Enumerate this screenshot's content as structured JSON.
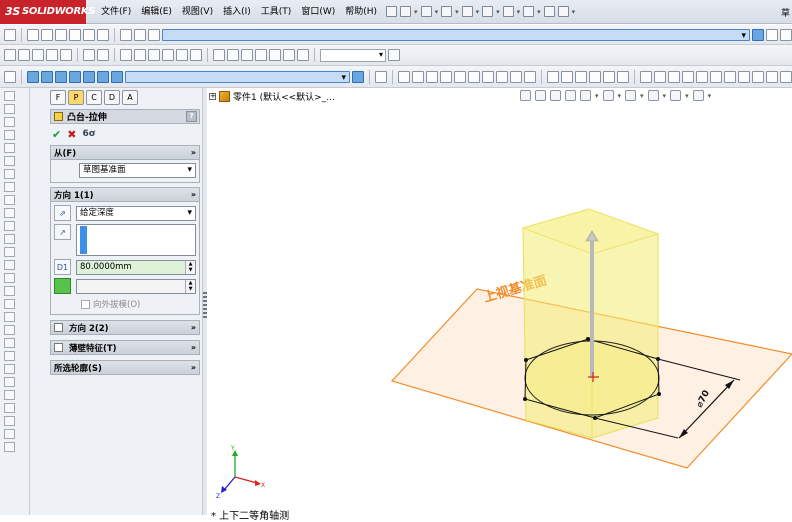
{
  "app": {
    "brand": "SOLIDWORKS",
    "corner_text": "草"
  },
  "menu": [
    "文件(F)",
    "编辑(E)",
    "视图(V)",
    "插入(I)",
    "工具(T)",
    "窗口(W)",
    "帮助(H)"
  ],
  "feature_tabs": [
    "F",
    "P",
    "C",
    "D",
    "A"
  ],
  "feature": {
    "title": "凸台-拉伸",
    "help": "?",
    "confirm": {
      "ok": "✔",
      "cancel": "✖",
      "pin": "6ơ"
    },
    "from": {
      "header": "从(F)",
      "chevron": "»",
      "value": "草图基准面"
    },
    "direction1": {
      "header": "方向 1(1)",
      "chevron": "»",
      "end_condition": "给定深度",
      "depth": "80.0000mm",
      "draft_outward": "向外拔模(O)",
      "icon_d1": "D1"
    },
    "direction2": {
      "header": "方向 2(2)",
      "chevron": "»"
    },
    "thin": {
      "header": "薄壁特征(T)",
      "chevron": "»"
    },
    "contours": {
      "header": "所选轮廓(S)",
      "chevron": "»"
    }
  },
  "tree": {
    "plus": "⊞",
    "item": "零件1 (默认<<默认>_..."
  },
  "viewport": {
    "plane_label": "上视基准面",
    "dimension": "⌀70",
    "view_orientation": "* 上下二等角轴测",
    "colors": {
      "plane": "#f28c28",
      "extrude": "#f3ec74",
      "triad_x": "#d22",
      "triad_y": "#2a2",
      "triad_z": "#22c"
    }
  }
}
